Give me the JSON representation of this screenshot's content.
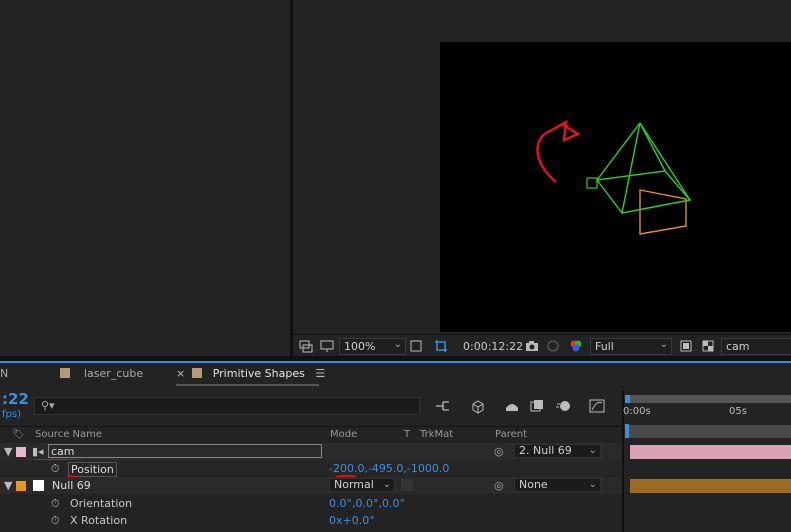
{
  "viewer": {
    "zoom": "100%",
    "timecode": "0:00:12:22",
    "resolution": "Full",
    "camera": "cam"
  },
  "timeline": {
    "tabs": [
      {
        "label": "N"
      },
      {
        "label": "laser_cube",
        "color": "#b49a7a"
      },
      {
        "label": "Primitive Shapes",
        "color": "#b49a7a"
      }
    ],
    "timecode": ":22",
    "fps": "fps)",
    "columns": {
      "source_name": "Source Name",
      "mode": "Mode",
      "t": "T",
      "trkmat": "TrkMat",
      "parent": "Parent"
    },
    "rows": [
      {
        "name": "cam",
        "parent": "2. Null 69",
        "label_color": "#e8b8cc"
      },
      {
        "name": "Position",
        "value": "-200.0,-495.0,-1000.0"
      },
      {
        "name": "Null 69",
        "mode": "Normal",
        "parent": "None",
        "label_color": "#e8961e"
      },
      {
        "name": "Orientation",
        "value": "0.0°,0.0°,0.0°"
      },
      {
        "name": "X Rotation",
        "value": "0x+0.0°"
      }
    ],
    "ruler": {
      "start": "0:00s",
      "tick": "05s"
    },
    "track_colors": {
      "cam": "#d7a0b4",
      "null": "#9a6b25"
    }
  }
}
